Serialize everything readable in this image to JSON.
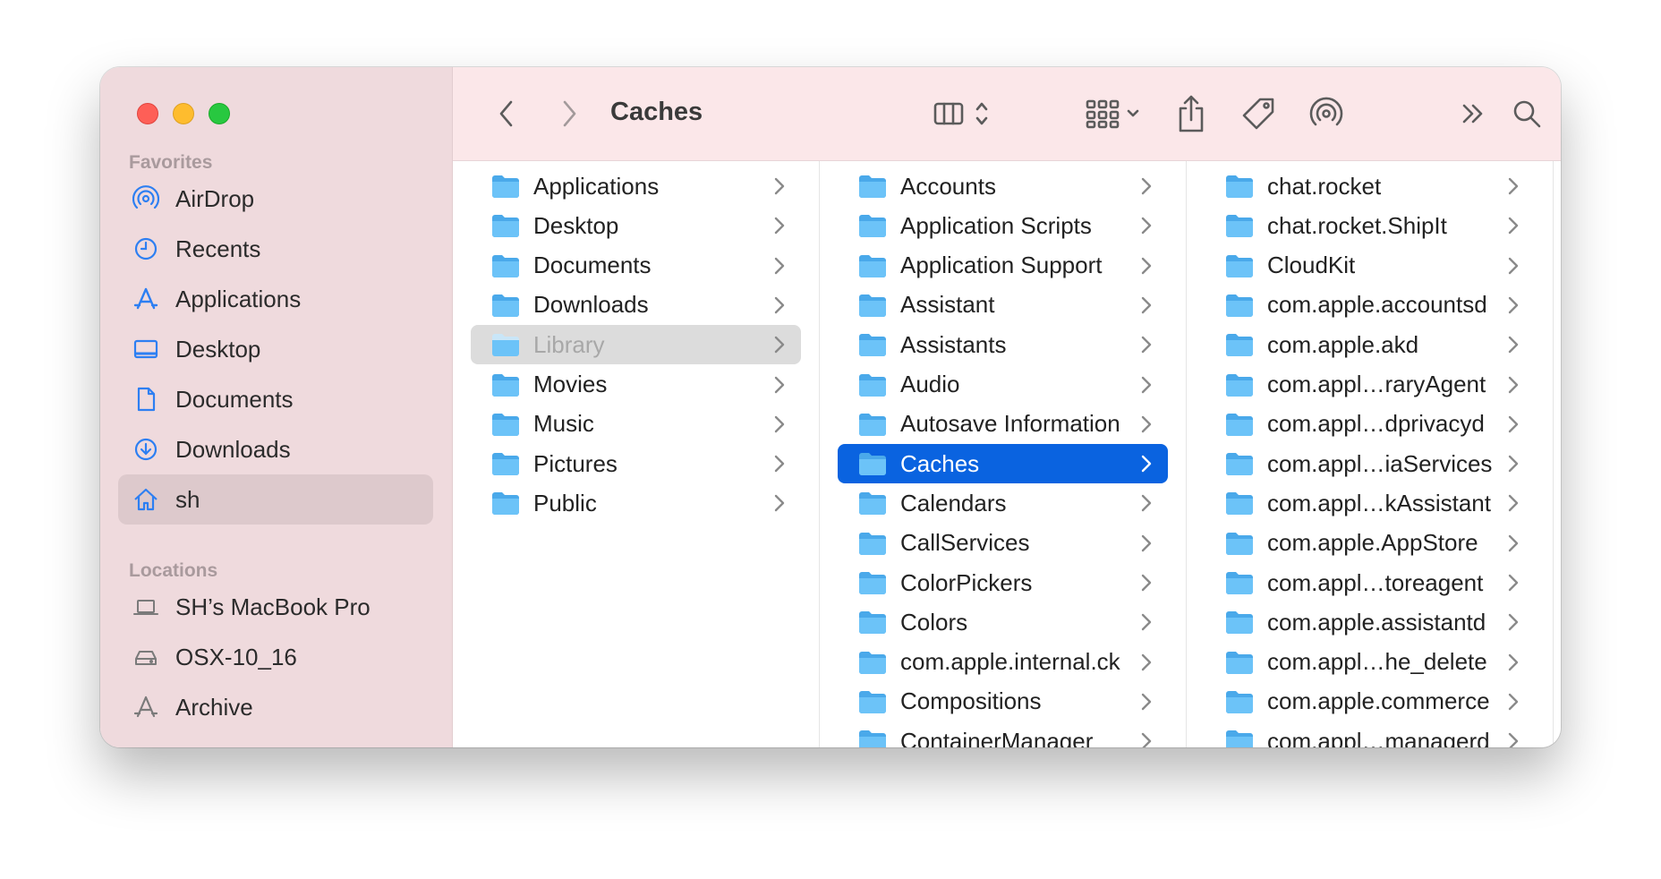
{
  "window": {
    "title": "Caches",
    "colors": {
      "accent": "#0a63e0",
      "sidebar_bg": "#efdadd",
      "toolbar_bg": "#fbe7e9",
      "folder": "#5ab7f3"
    }
  },
  "toolbar": {
    "back_icon": "chevron-left-icon",
    "forward_icon": "chevron-right-icon",
    "view_icon": "column-view-icon",
    "group_icon": "grid-group-icon",
    "share_icon": "share-icon",
    "tag_icon": "tag-icon",
    "airdrop_icon": "airdrop-icon",
    "more_icon": "double-chevron-icon",
    "search_icon": "search-icon"
  },
  "sidebar": {
    "favorites_title": "Favorites",
    "favorites": [
      {
        "label": "AirDrop",
        "icon": "airdrop-icon"
      },
      {
        "label": "Recents",
        "icon": "clock-icon"
      },
      {
        "label": "Applications",
        "icon": "applications-icon"
      },
      {
        "label": "Desktop",
        "icon": "desktop-icon"
      },
      {
        "label": "Documents",
        "icon": "document-icon"
      },
      {
        "label": "Downloads",
        "icon": "download-icon"
      },
      {
        "label": "sh",
        "icon": "home-icon",
        "selected": true
      }
    ],
    "locations_title": "Locations",
    "locations": [
      {
        "label": "SH’s MacBook Pro",
        "icon": "laptop-icon"
      },
      {
        "label": "OSX-10_16",
        "icon": "disk-icon"
      },
      {
        "label": "Archive",
        "icon": "archive-icon"
      }
    ]
  },
  "columns": [
    {
      "items": [
        {
          "label": "Applications",
          "state": ""
        },
        {
          "label": "Desktop",
          "state": ""
        },
        {
          "label": "Documents",
          "state": ""
        },
        {
          "label": "Downloads",
          "state": ""
        },
        {
          "label": "Library",
          "state": "dim"
        },
        {
          "label": "Movies",
          "state": ""
        },
        {
          "label": "Music",
          "state": ""
        },
        {
          "label": "Pictures",
          "state": ""
        },
        {
          "label": "Public",
          "state": ""
        }
      ]
    },
    {
      "items": [
        {
          "label": "Accounts",
          "state": ""
        },
        {
          "label": "Application Scripts",
          "state": ""
        },
        {
          "label": "Application Support",
          "state": ""
        },
        {
          "label": "Assistant",
          "state": ""
        },
        {
          "label": "Assistants",
          "state": ""
        },
        {
          "label": "Audio",
          "state": ""
        },
        {
          "label": "Autosave Information",
          "state": ""
        },
        {
          "label": "Caches",
          "state": "active"
        },
        {
          "label": "Calendars",
          "state": ""
        },
        {
          "label": "CallServices",
          "state": ""
        },
        {
          "label": "ColorPickers",
          "state": ""
        },
        {
          "label": "Colors",
          "state": ""
        },
        {
          "label": "com.apple.internal.ck",
          "state": ""
        },
        {
          "label": "Compositions",
          "state": ""
        },
        {
          "label": "ContainerManager",
          "state": ""
        }
      ]
    },
    {
      "items": [
        {
          "label": "chat.rocket",
          "state": ""
        },
        {
          "label": "chat.rocket.ShipIt",
          "state": ""
        },
        {
          "label": "CloudKit",
          "state": ""
        },
        {
          "label": "com.apple.accountsd",
          "state": ""
        },
        {
          "label": "com.apple.akd",
          "state": ""
        },
        {
          "label": "com.appl…raryAgent",
          "state": ""
        },
        {
          "label": "com.appl…dprivacyd",
          "state": ""
        },
        {
          "label": "com.appl…iaServices",
          "state": ""
        },
        {
          "label": "com.appl…kAssistant",
          "state": ""
        },
        {
          "label": "com.apple.AppStore",
          "state": ""
        },
        {
          "label": "com.appl…toreagent",
          "state": ""
        },
        {
          "label": "com.apple.assistantd",
          "state": ""
        },
        {
          "label": "com.appl…he_delete",
          "state": ""
        },
        {
          "label": "com.apple.commerce",
          "state": ""
        },
        {
          "label": "com.appl…managerd",
          "state": ""
        }
      ]
    }
  ]
}
